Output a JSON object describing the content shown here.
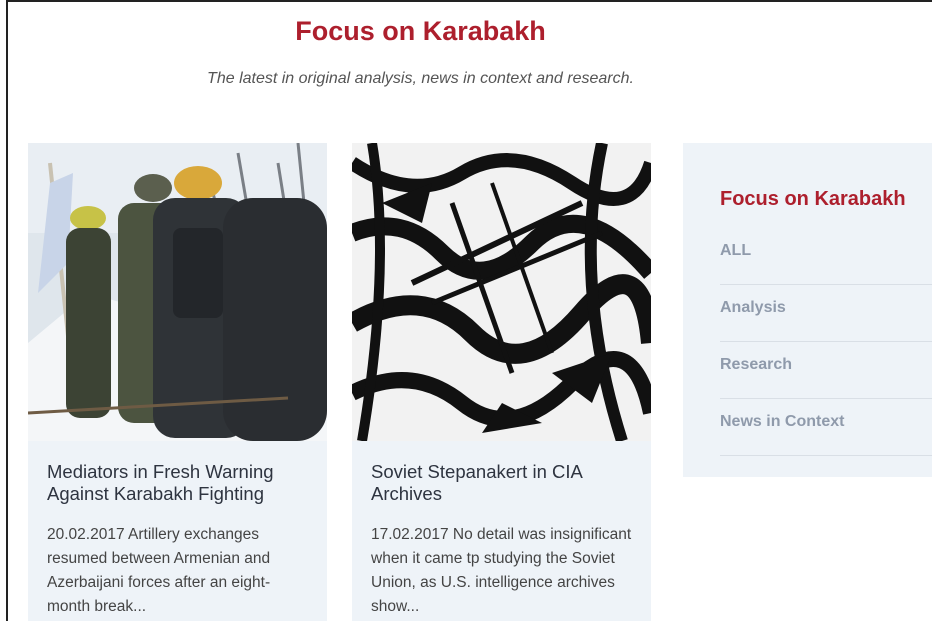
{
  "header": {
    "title": "Focus on Karabakh",
    "subtitle": "The latest in original analysis, news in context and research."
  },
  "articles": [
    {
      "title": "Mediators in Fresh Warning Against Karabakh Fighting",
      "excerpt": "20.02.2017 Artillery exchanges resumed between Armenian and Azerbaijani forces after an eight-month break..."
    },
    {
      "title": "Soviet Stepanakert in CIA Archives",
      "excerpt": "17.02.2017 No detail was insignificant when it came tp studying the Soviet Union, as U.S. intelligence archives show..."
    }
  ],
  "sidebar": {
    "title": "Focus on Karabakh",
    "items": [
      {
        "label": "ALL"
      },
      {
        "label": "Analysis"
      },
      {
        "label": "Research"
      },
      {
        "label": "News in Context"
      }
    ]
  },
  "colors": {
    "brand": "#ad1f2d",
    "card_background": "#eef3f8",
    "sidebar_link": "#8f9aab"
  }
}
